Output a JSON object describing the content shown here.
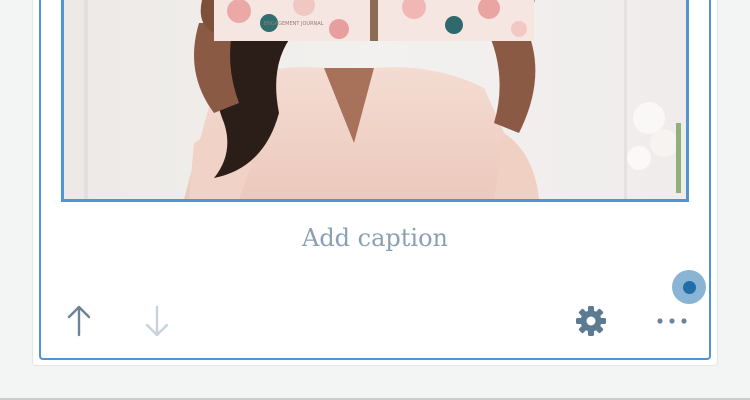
{
  "image_block": {
    "caption_placeholder": "Add caption",
    "cover_text": "ENGAGEMENT JOURNAL",
    "accent_color": "#4f94d4"
  },
  "toolbar": {
    "move_up": "move-up-icon",
    "move_down": "move-down-icon",
    "settings": "gear-icon",
    "more": "more-options-icon"
  },
  "colors": {
    "enabled_icon": "#6d8399",
    "disabled_icon": "#c9d2da",
    "settings_icon": "#5d7a93",
    "insertion_point": "#8ab4d4"
  }
}
